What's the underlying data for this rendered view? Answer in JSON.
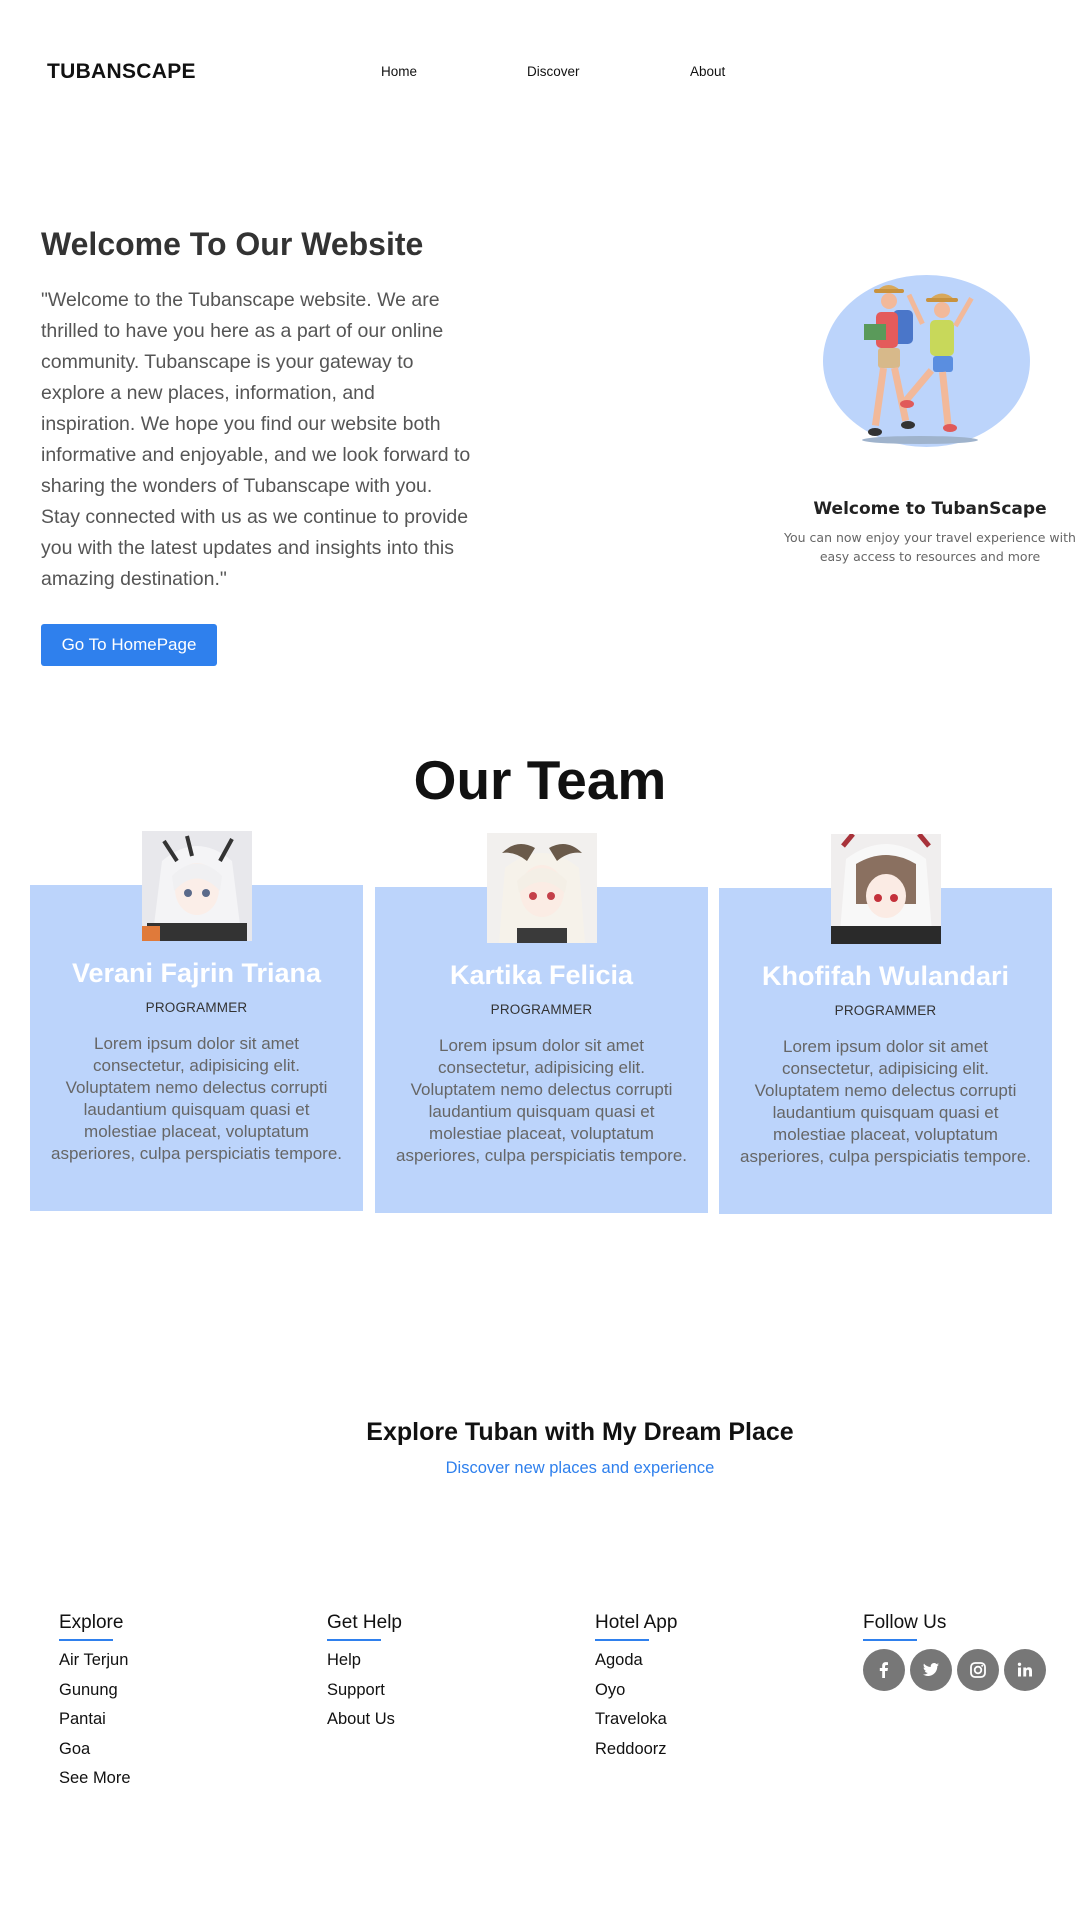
{
  "nav": {
    "logo": "TUBANSCAPE",
    "links": [
      "Home",
      "Discover",
      "About"
    ]
  },
  "hero": {
    "title": "Welcome To Our Website",
    "text": "\"Welcome to the Tubanscape website. We are thrilled to have you here as a part of our online community. Tubanscape is your gateway to explore a new places, information, and inspiration. We hope you find our website both informative and enjoyable, and we look forward to sharing the wonders of Tubanscape with you. Stay connected with us as we continue to provide you with the latest updates and insights into this amazing destination.\"",
    "button": "Go To HomePage",
    "illustration_title": "Welcome to TubanScape",
    "illustration_sub": "You can now enjoy your travel experience with easy access to resources and more"
  },
  "team": {
    "title": "Our Team",
    "members": [
      {
        "name": "Verani Fajrin Triana",
        "role": "PROGRAMMER",
        "desc": "Lorem ipsum dolor sit amet consectetur, adipisicing elit. Voluptatem nemo delectus corrupti laudantium quisquam quasi et molestiae placeat, voluptatum asperiores, culpa perspiciatis tempore."
      },
      {
        "name": "Kartika Felicia",
        "role": "PROGRAMMER",
        "desc": "Lorem ipsum dolor sit amet consectetur, adipisicing elit. Voluptatem nemo delectus corrupti laudantium quisquam quasi et molestiae placeat, voluptatum asperiores, culpa perspiciatis tempore."
      },
      {
        "name": "Khofifah Wulandari",
        "role": "PROGRAMMER",
        "desc": "Lorem ipsum dolor sit amet consectetur, adipisicing elit. Voluptatem nemo delectus corrupti laudantium quisquam quasi et molestiae placeat, voluptatum asperiores, culpa perspiciatis tempore."
      }
    ]
  },
  "explore": {
    "title": "Explore Tuban with My Dream Place",
    "subtitle": "Discover new places and experience"
  },
  "footer": {
    "explore": {
      "title": "Explore",
      "links": [
        "Air Terjun",
        "Gunung",
        "Pantai",
        "Goa",
        "See More"
      ]
    },
    "help": {
      "title": "Get Help",
      "links": [
        "Help",
        "Support",
        "About Us"
      ]
    },
    "hotel": {
      "title": "Hotel App",
      "links": [
        "Agoda",
        "Oyo",
        "Traveloka",
        "Reddoorz"
      ]
    },
    "follow": {
      "title": "Follow Us",
      "icons": [
        "facebook-icon",
        "twitter-icon",
        "instagram-icon",
        "linkedin-icon"
      ]
    }
  },
  "colors": {
    "accent": "#2f80ed",
    "card_bg": "#bcd4fb",
    "social_bg": "#777777"
  }
}
